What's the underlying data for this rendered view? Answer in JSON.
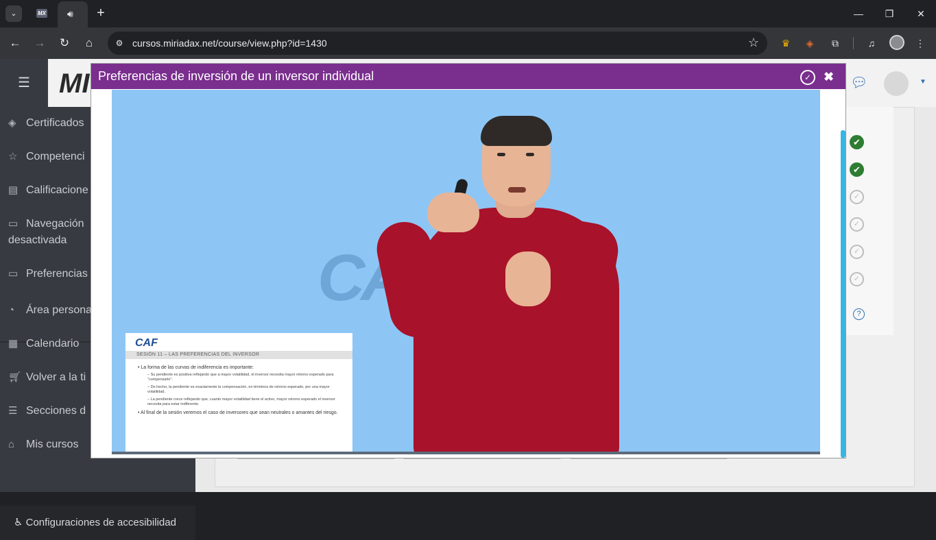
{
  "browser": {
    "tab_favicon_text": "MX",
    "url": "cursos.miriadax.net/course/view.php?id=1430"
  },
  "site": {
    "brand": "MI"
  },
  "sidebar": {
    "items": [
      {
        "label": "Certificados",
        "icon": "layers-icon"
      },
      {
        "label": "Competenci",
        "icon": "star-icon"
      },
      {
        "label": "Calificacione",
        "icon": "gradebook-icon"
      },
      {
        "label": "Navegación",
        "label2": "desactivada",
        "icon": "folder-icon"
      },
      {
        "label": "Preferencias",
        "icon": "folder-icon"
      },
      {
        "label": "Área persona",
        "icon": "dashboard-icon"
      },
      {
        "label": "Calendario",
        "icon": "calendar-icon"
      },
      {
        "label": "Volver a la ti",
        "icon": "cart-icon"
      },
      {
        "label": "Secciones d",
        "icon": "list-icon"
      },
      {
        "label": "Mis cursos",
        "icon": "graduation-cap-icon"
      }
    ],
    "accessibility": "Configuraciones de accesibilidad"
  },
  "modal": {
    "title": "Preferencias de inversión de un inversor individual"
  },
  "video": {
    "watermark": "CAF",
    "slide": {
      "logo": "CAF",
      "heading": "SESIÓN 11 – LAS PREFERENCIAS DEL INVERSOR",
      "bullet1": "La forma de las curvas de indiferencia es importante:",
      "sub1": "Su pendiente es positiva reflejando que a mayor volatilidad, el inversor necesita mayor retorno esperado para \"compensarle\".",
      "sub2": "De hecho, la pendiente es exactamente la compensación, en términos de retorno esperado, por una mayor volatilidad.",
      "sub3": "La pendiente crece reflejando que, cuanto mayor volatilidad tiene el activo, mayor retorno esperado el inversor necesita para estar indiferente.",
      "bullet2": "Al final de la sesión veremos el caso de inversores que sean neutrales o amantes del riesgo."
    }
  },
  "activity_status": [
    "completed",
    "completed",
    "not-completed",
    "not-completed",
    "not-completed",
    "not-completed"
  ]
}
